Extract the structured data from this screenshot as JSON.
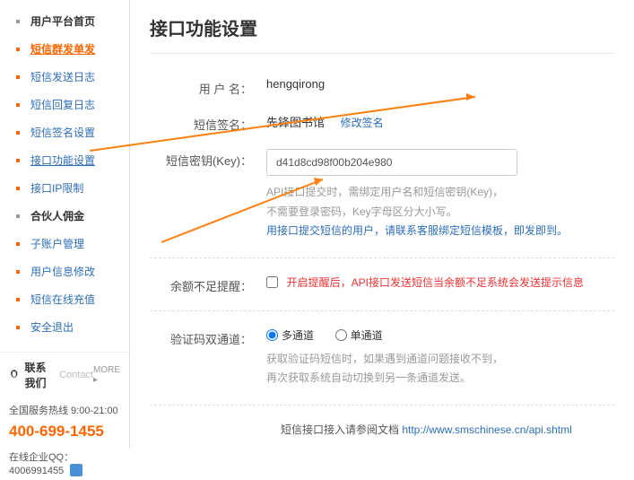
{
  "sidebar": {
    "items": [
      {
        "label": "用户平台首页",
        "type": "section"
      },
      {
        "label": "短信群发单发",
        "type": "active"
      },
      {
        "label": "短信发送日志",
        "type": "link"
      },
      {
        "label": "短信回复日志",
        "type": "link"
      },
      {
        "label": "短信签名设置",
        "type": "link"
      },
      {
        "label": "接口功能设置",
        "type": "current"
      },
      {
        "label": "接口IP限制",
        "type": "link"
      },
      {
        "label": "合伙人佣金",
        "type": "section"
      },
      {
        "label": "子账户管理",
        "type": "link"
      },
      {
        "label": "用户信息修改",
        "type": "link"
      },
      {
        "label": "短信在线充值",
        "type": "link"
      },
      {
        "label": "安全退出",
        "type": "link"
      }
    ],
    "contact": {
      "label": "联系我们",
      "sub": "Contact",
      "more": "MORE ▸"
    },
    "hotline_label": "全国服务热线 9:00-21:00",
    "hotline_number": "400-699-1455",
    "qq_label": "在线企业QQ：",
    "qq_number": "4006991455"
  },
  "main": {
    "title": "接口功能设置",
    "user_label": "用 户 名：",
    "user_value": "hengqirong",
    "sign_label": "短信签名：",
    "sign_value": "先锋图书馆",
    "sign_edit": "修改签名",
    "key_label": "短信密钥(Key)：",
    "key_value": "d41d8cd98f00b204e980",
    "key_hint1": "API接口提交时，需绑定用户名和短信密钥(Key)，",
    "key_hint2": "不需要登录密码，Key字母区分大小写。",
    "key_hint3": "用接口提交短信的用户，请联系客服绑定短信模板，即发即到。",
    "balance_label": "余额不足提醒：",
    "balance_text": "开启提醒后，API接口发送短信当余额不足系统会发送提示信息",
    "channel_label": "验证码双通道：",
    "channel_opt1": "多通道",
    "channel_opt2": "单通道",
    "channel_hint1": "获取验证码短信时，如果遇到通道问题接收不到，",
    "channel_hint2": "再次获取系统自动切换到另一条通道发送。",
    "footer_text": "短信接口接入请参阅文档 ",
    "footer_url": "http://www.smschinese.cn/api.shtml"
  }
}
